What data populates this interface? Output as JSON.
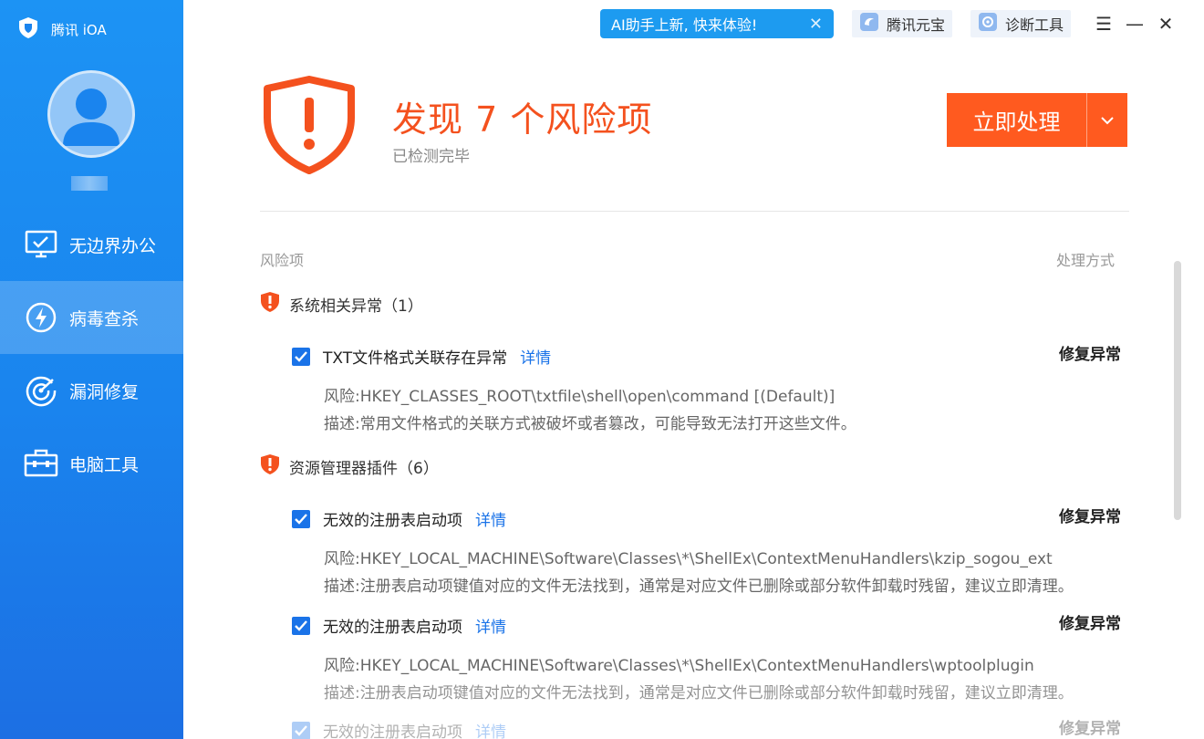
{
  "app": {
    "name": "腾讯 iOA"
  },
  "colors": {
    "accent": "#1a73e8",
    "danger": "#f4511e",
    "sidebar": "#1a84ee",
    "ai_banner": "#1d9bf0"
  },
  "topbar": {
    "ai_banner": "AI助手上新, 快来体验!",
    "tools": [
      {
        "label": "腾讯元宝",
        "icon": "yuanbao-icon"
      },
      {
        "label": "诊断工具",
        "icon": "diagnose-icon"
      }
    ],
    "window_controls": [
      "menu-icon",
      "minimize-icon",
      "close-icon"
    ]
  },
  "sidebar": {
    "items": [
      {
        "label": "无边界办公",
        "icon": "monitor-icon",
        "active": false
      },
      {
        "label": "病毒查杀",
        "icon": "lightning-shield-icon",
        "active": true
      },
      {
        "label": "漏洞修复",
        "icon": "target-icon",
        "active": false
      },
      {
        "label": "电脑工具",
        "icon": "toolbox-icon",
        "active": false
      }
    ]
  },
  "header": {
    "title": "发现 7 个风险项",
    "subtitle": "已检测完毕",
    "primary_button": "立即处理"
  },
  "list": {
    "col_risk": "风险项",
    "col_action": "处理方式",
    "groups": [
      {
        "label": "系统相关异常（1）"
      },
      {
        "label": "资源管理器插件（6）"
      }
    ],
    "items": [
      {
        "title": "TXT文件格式关联存在异常",
        "detail": "详情",
        "action": "修复异常",
        "risk": "风险:HKEY_CLASSES_ROOT\\txtfile\\shell\\open\\command [(Default)]",
        "desc": "描述:常用文件格式的关联方式被破坏或者篡改，可能导致无法打开这些文件。"
      },
      {
        "title": "无效的注册表启动项",
        "detail": "详情",
        "action": "修复异常",
        "risk": "风险:HKEY_LOCAL_MACHINE\\Software\\Classes\\*\\ShellEx\\ContextMenuHandlers\\kzip_sogou_ext",
        "desc": "描述:注册表启动项键值对应的文件无法找到，通常是对应文件已删除或部分软件卸载时残留，建议立即清理。"
      },
      {
        "title": "无效的注册表启动项",
        "detail": "详情",
        "action": "修复异常",
        "risk": "风险:HKEY_LOCAL_MACHINE\\Software\\Classes\\*\\ShellEx\\ContextMenuHandlers\\wptoolplugin",
        "desc": "描述:注册表启动项键值对应的文件无法找到，通常是对应文件已删除或部分软件卸载时残留，建议立即清理。"
      },
      {
        "title": "无效的注册表启动项",
        "detail": "详情",
        "action": "修复异常",
        "risk": "",
        "desc": ""
      }
    ]
  }
}
